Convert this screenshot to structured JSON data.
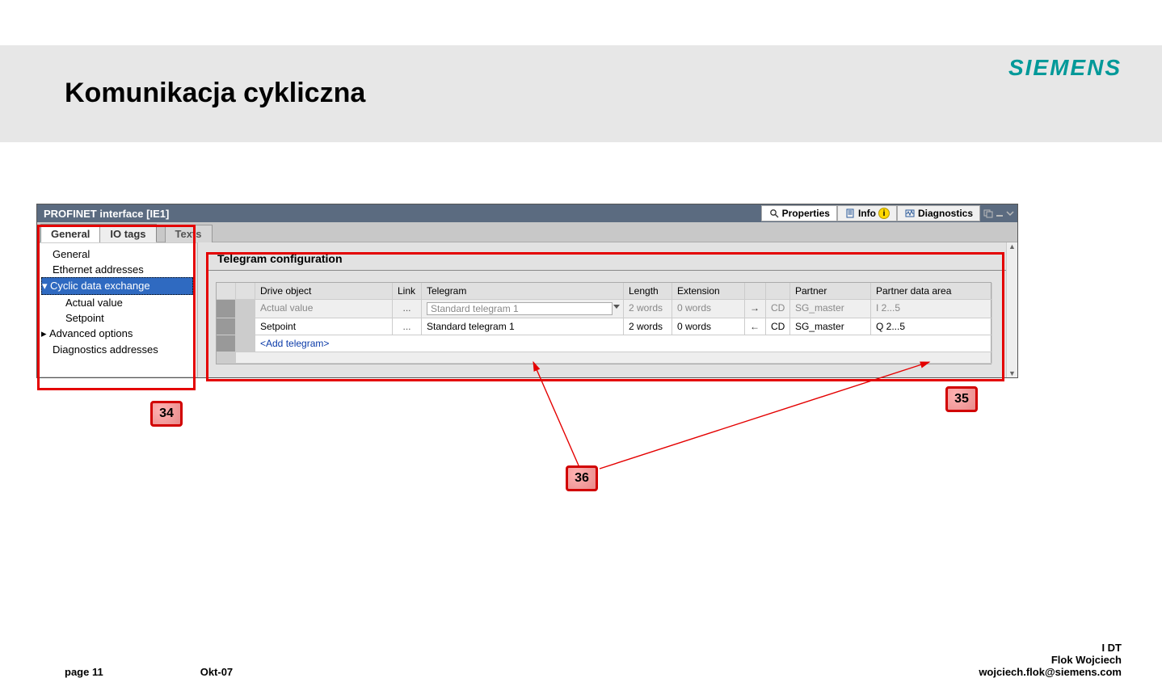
{
  "brand": "SIEMENS",
  "slide": {
    "title": "Komunikacja cykliczna"
  },
  "window": {
    "title": "PROFINET interface [IE1]",
    "rtabs": {
      "properties": "Properties",
      "info": "Info",
      "diagnostics": "Diagnostics"
    }
  },
  "top_tabs": {
    "general": "General",
    "io_tags": "IO tags",
    "texts": "Texts"
  },
  "nav": {
    "general": "General",
    "ethernet": "Ethernet addresses",
    "cyclic": "Cyclic data exchange",
    "actual": "Actual value",
    "setpoint": "Setpoint",
    "advanced": "Advanced options",
    "diag": "Diagnostics addresses"
  },
  "panel": {
    "title": "Telegram configuration",
    "headers": {
      "drive": "Drive object",
      "link": "Link",
      "telegram": "Telegram",
      "length": "Length",
      "extension": "Extension",
      "partner": "Partner",
      "partner_area": "Partner data area"
    },
    "rows": [
      {
        "drive": "Actual value",
        "link": "...",
        "telegram": "Standard telegram 1",
        "length": "2  words",
        "extension": "0  words",
        "dir": "→",
        "cd": "CD",
        "partner": "SG_master",
        "area": "I 2...5"
      },
      {
        "drive": "Setpoint",
        "link": "...",
        "telegram": "Standard telegram 1",
        "length": "2  words",
        "extension": "0  words",
        "dir": "←",
        "cd": "CD",
        "partner": "SG_master",
        "area": "Q 2...5"
      }
    ],
    "add_row": "<Add telegram>"
  },
  "callouts": {
    "c34": "34",
    "c35": "35",
    "c36": "36"
  },
  "footer": {
    "page": "page 11",
    "date": "Okt-07",
    "org": "I DT",
    "name": "Flok Wojciech",
    "email": "wojciech.flok@siemens.com"
  }
}
